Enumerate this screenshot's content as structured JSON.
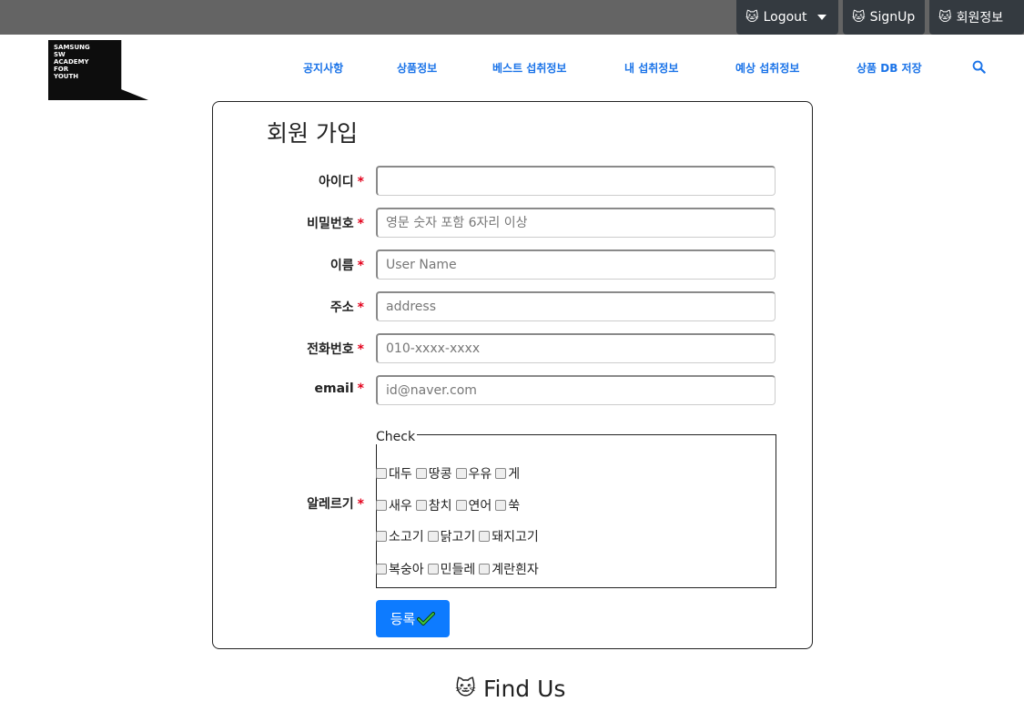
{
  "topbar": {
    "logout_label": "Logout",
    "signup_label": "SignUp",
    "member_info_label": "회원정보"
  },
  "logo": {
    "lines": [
      "SAMSUNG",
      "SW",
      "ACADEMY",
      "FOR",
      "YOUTH"
    ]
  },
  "nav": {
    "items": [
      "공지사항",
      "상품정보",
      "베스트 섭취정보",
      "내 섭취정보",
      "예상 섭취정보",
      "상품 DB 저장"
    ]
  },
  "form": {
    "title": "회원 가입",
    "required_mark": "*",
    "fields": [
      {
        "label": "아이디",
        "placeholder": ""
      },
      {
        "label": "비밀번호",
        "placeholder": "영문 숫자 포함 6자리 이상"
      },
      {
        "label": "이름",
        "placeholder": "User Name"
      },
      {
        "label": "주소",
        "placeholder": "address"
      },
      {
        "label": "전화번호",
        "placeholder": "010-xxxx-xxxx"
      },
      {
        "label": "email",
        "placeholder": "id@naver.com"
      }
    ],
    "allergy": {
      "label": "알레르기",
      "legend": "Check",
      "rows": [
        [
          "대두",
          "땅콩",
          "우유",
          "게"
        ],
        [
          "새우",
          "참치",
          "연어",
          "쑥"
        ],
        [
          "소고기",
          "닭고기",
          "돼지고기"
        ],
        [
          "복숭아",
          "민들레",
          "계란흰자"
        ]
      ]
    },
    "submit_label": "등록"
  },
  "footer": {
    "findus_label": "Find Us"
  },
  "colors": {
    "topbar_bg": "#646464",
    "topbtn_bg": "#343a40",
    "nav_link": "#1a73e8",
    "required": "#e3001b",
    "submit_bg": "#0d7bff"
  }
}
